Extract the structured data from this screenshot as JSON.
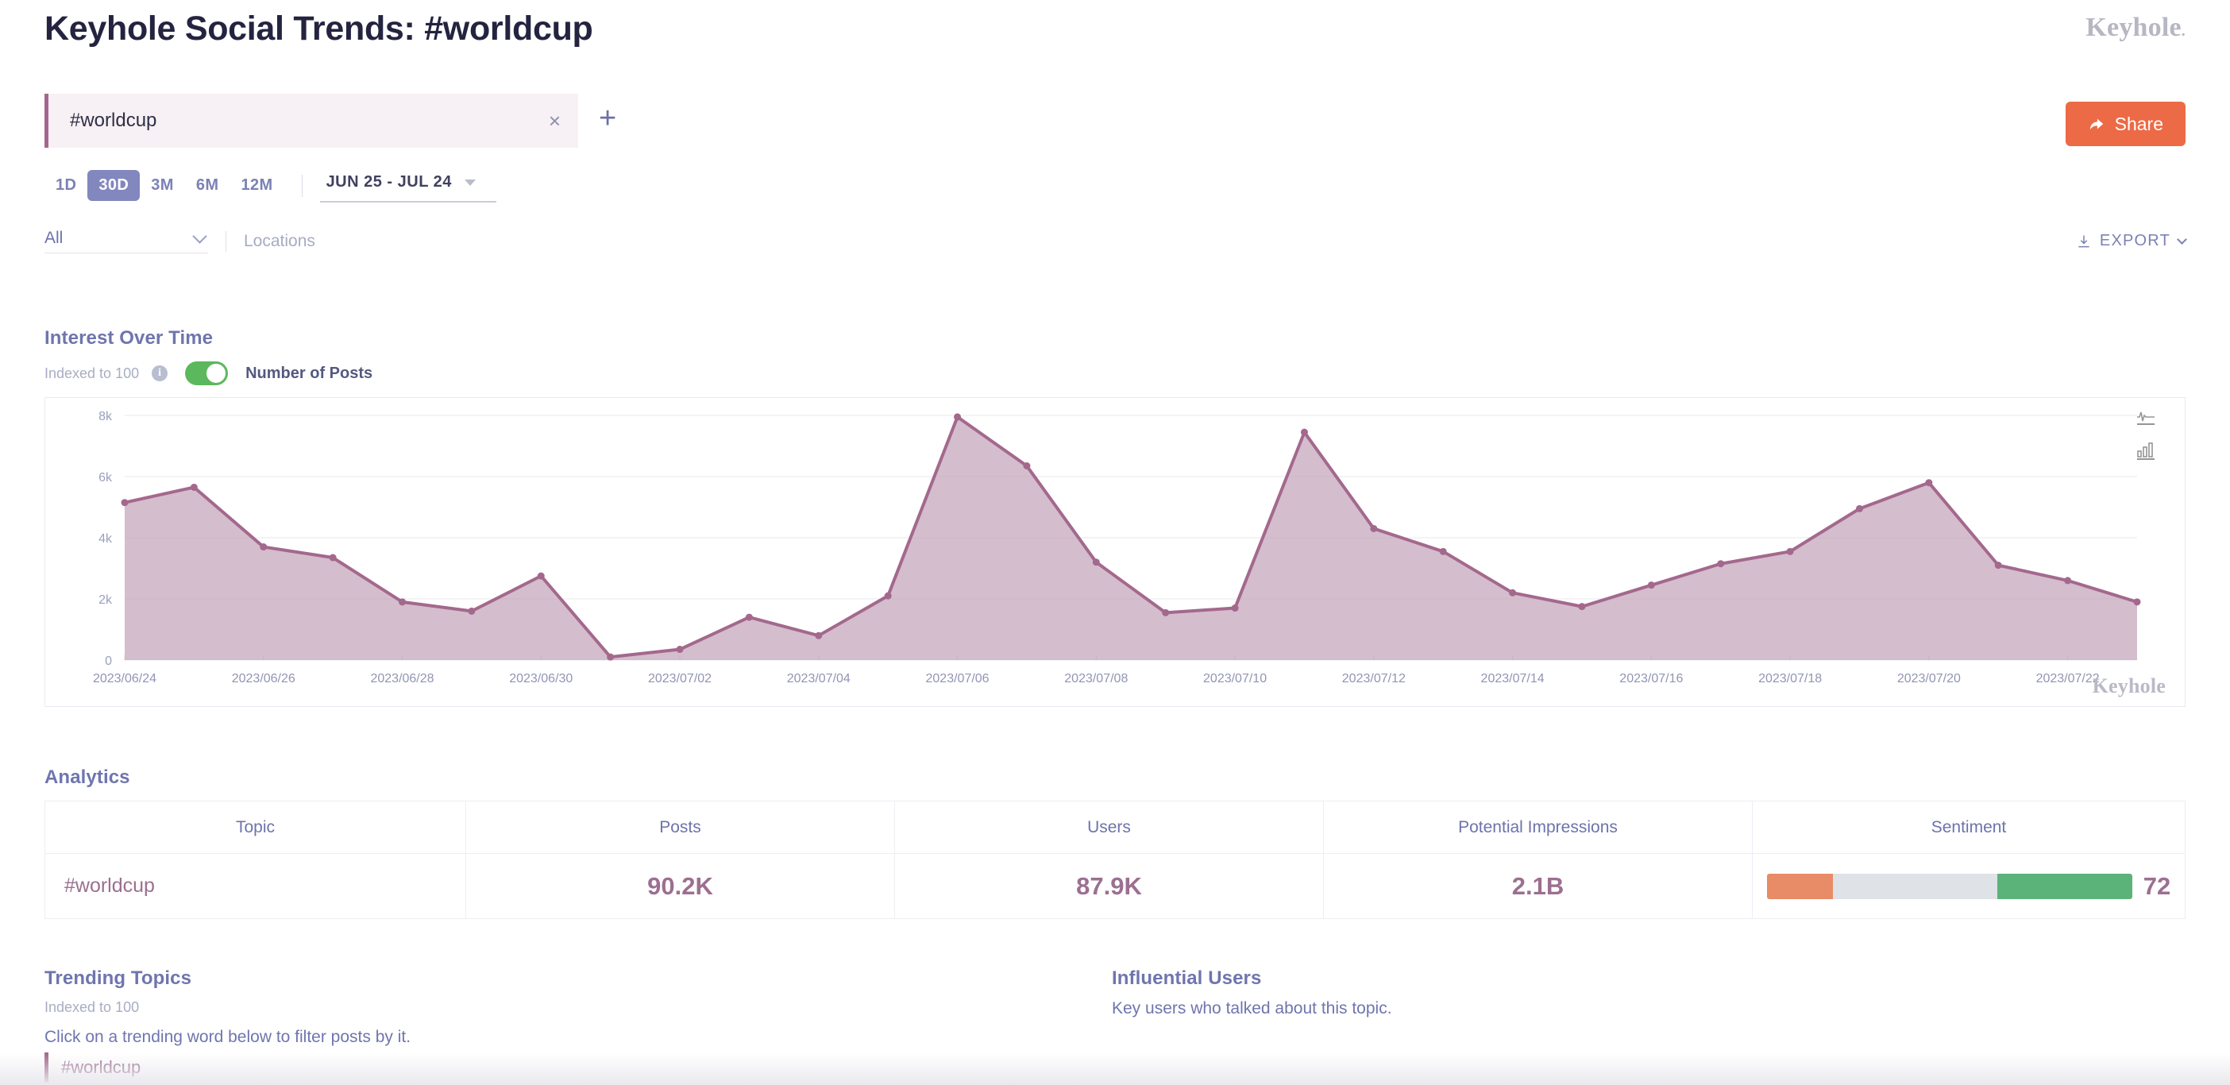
{
  "header": {
    "title": "Keyhole Social Trends: #worldcup",
    "brand": "Keyhole",
    "brand_dot": "."
  },
  "topics": {
    "chips": [
      {
        "label": "#worldcup",
        "close_icon": "close-icon"
      }
    ],
    "add_label": "+"
  },
  "share": {
    "label": "Share",
    "icon": "share-icon",
    "color": "#ec6a45"
  },
  "timerange": {
    "options": [
      "1D",
      "30D",
      "3M",
      "6M",
      "12M"
    ],
    "selected": "30D",
    "date_label": "JUN 25 - JUL 24"
  },
  "filters": {
    "select_value": "All",
    "locations_label": "Locations",
    "export_label": "EXPORT",
    "export_icon": "download-icon"
  },
  "interest": {
    "title": "Interest Over Time",
    "indexed_label": "Indexed to 100",
    "info_icon": "info-icon",
    "toggle_label": "Number of Posts",
    "toggle_on": true,
    "toggle_color": "#5cb85c",
    "watermark": "Keyhole",
    "tools": [
      "line-chart-icon",
      "bar-chart-icon"
    ]
  },
  "chart_data": {
    "type": "area",
    "title": "Interest Over Time",
    "xlabel": "",
    "ylabel": "",
    "ylim": [
      0,
      8000
    ],
    "yticks": [
      0,
      2000,
      4000,
      6000,
      8000
    ],
    "ytick_labels": [
      "0",
      "2k",
      "4k",
      "6k",
      "8k"
    ],
    "grid": true,
    "legend": "none",
    "line_color": "#a4688d",
    "fill_color": "#c4a3b9",
    "xtick_labels": [
      "2023/06/24",
      "2023/06/26",
      "2023/06/28",
      "2023/06/30",
      "2023/07/02",
      "2023/07/04",
      "2023/07/06",
      "2023/07/08",
      "2023/07/10",
      "2023/07/12",
      "2023/07/14",
      "2023/07/16",
      "2023/07/18",
      "2023/07/20",
      "2023/07/22"
    ],
    "x": [
      "2023/06/24",
      "2023/06/25",
      "2023/06/26",
      "2023/06/27",
      "2023/06/28",
      "2023/06/29",
      "2023/06/30",
      "2023/07/01",
      "2023/07/02",
      "2023/07/03",
      "2023/07/04",
      "2023/07/05",
      "2023/07/06",
      "2023/07/07",
      "2023/07/08",
      "2023/07/09",
      "2023/07/10",
      "2023/07/11",
      "2023/07/12",
      "2023/07/13",
      "2023/07/14",
      "2023/07/15",
      "2023/07/16",
      "2023/07/17",
      "2023/07/18",
      "2023/07/19",
      "2023/07/20",
      "2023/07/21",
      "2023/07/22",
      "2023/07/23"
    ],
    "values": [
      5150,
      5650,
      3700,
      3350,
      1900,
      1600,
      2750,
      100,
      350,
      1400,
      800,
      2100,
      7950,
      6350,
      3200,
      1550,
      1700,
      7450,
      4300,
      3550,
      2200,
      1750,
      2450,
      3150,
      3550,
      4950,
      5800,
      3100,
      2600,
      1900
    ]
  },
  "analytics": {
    "title": "Analytics",
    "columns": [
      "Topic",
      "Posts",
      "Users",
      "Potential Impressions",
      "Sentiment"
    ],
    "rows": [
      {
        "topic": "#worldcup",
        "posts": "90.2K",
        "users": "87.9K",
        "impressions": "2.1B",
        "sentiment_score": "72",
        "sentiment_negative_pct": 18,
        "sentiment_neutral_pct": 45,
        "sentiment_positive_pct": 37,
        "sentiment_negative_color": "#e88b67",
        "sentiment_neutral_color": "#dfe2e6",
        "sentiment_positive_color": "#5cb37a"
      }
    ]
  },
  "trending": {
    "title": "Trending Topics",
    "indexed_label": "Indexed to 100",
    "hint": "Click on a trending word below to filter posts by it.",
    "words": [
      "#worldcup"
    ]
  },
  "influential": {
    "title": "Influential Users",
    "subtitle": "Key users who talked about this topic."
  }
}
